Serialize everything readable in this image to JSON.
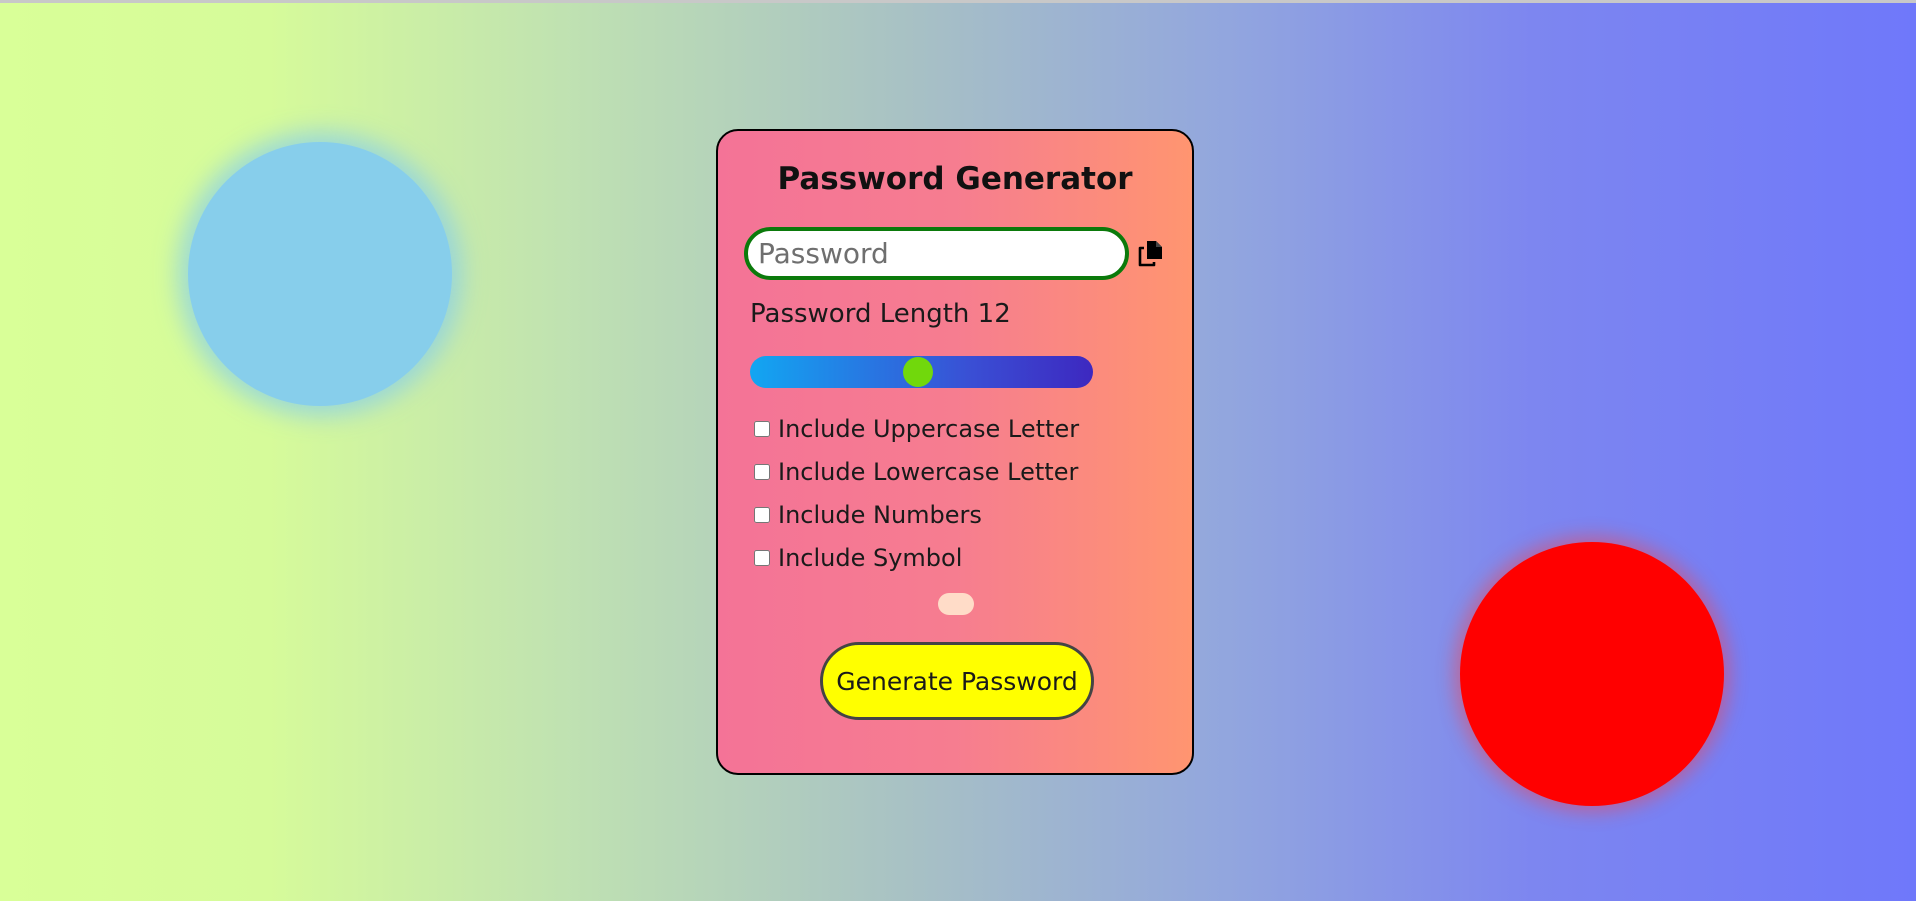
{
  "app": {
    "title": "Password Generator"
  },
  "password": {
    "placeholder": "Password",
    "value": ""
  },
  "copy": {
    "icon": "copy-icon"
  },
  "length": {
    "label": "Password Length",
    "value": "12",
    "slider_fraction": 0.49
  },
  "options": [
    {
      "label": "Include Uppercase Letter",
      "checked": false
    },
    {
      "label": "Include Lowercase Letter",
      "checked": false
    },
    {
      "label": "Include Numbers",
      "checked": false
    },
    {
      "label": "Include Symbol",
      "checked": false
    }
  ],
  "generate": {
    "label": "Generate Password"
  },
  "colors": {
    "card_border": "#000000",
    "input_border": "#0b7a0b",
    "slider_thumb": "#71d80c",
    "button_bg": "#ffff00",
    "strength_indicator": "#ffdcc8",
    "blob_blue": "#87ceeb",
    "blob_red": "#ff0000"
  }
}
